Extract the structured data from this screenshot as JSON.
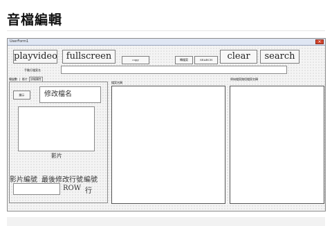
{
  "page": {
    "title": "音檔編輯"
  },
  "window": {
    "caption": "UserForm1",
    "close_glyph": "×"
  },
  "toolbar": {
    "playvideo": "playvideo",
    "fullscreen": "fullscreen",
    "copy": "copy",
    "middle_small": "轉檔案",
    "search_small": "SEARCH",
    "clear": "clear",
    "search": "search"
  },
  "rename_row": {
    "label": "手動打檔案名",
    "value": ""
  },
  "tabs": [
    "簡變數",
    "影片",
    "詳細屬性"
  ],
  "left_panel": {
    "small_button": "顯示",
    "rename_box": "修改檔名",
    "video_label": "影片",
    "header_1": "影片編號",
    "header_2": "最後修改行號",
    "header_3": "編號",
    "row_input": "",
    "row_label": "ROW",
    "line_label": "行"
  },
  "center_list": {
    "header": "檔案名稱"
  },
  "right_list": {
    "header": "原始檔案路徑檔案名稱"
  }
}
